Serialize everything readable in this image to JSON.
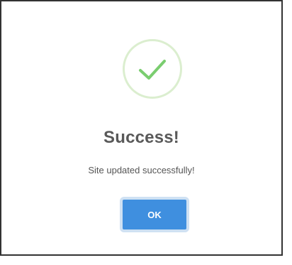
{
  "dialog": {
    "icon": "success-check-icon",
    "title": "Success!",
    "message": "Site updated successfully!",
    "ok_label": "OK"
  },
  "colors": {
    "success_green": "#7acd6f",
    "ring_green": "#dbeecf",
    "button_blue": "#3f8fdf",
    "title_gray": "#595959"
  }
}
